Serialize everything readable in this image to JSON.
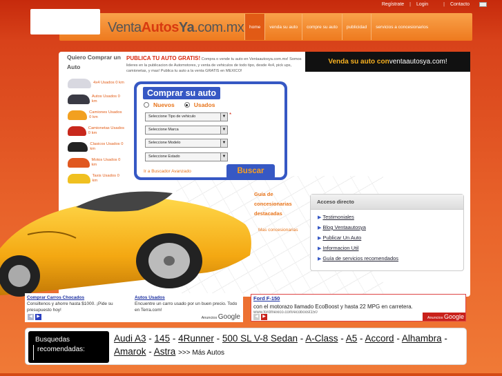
{
  "toplinks": {
    "registrate": "Regístrate",
    "login": "Login",
    "contacto": "Contacto"
  },
  "logo": {
    "part1": "Venta",
    "part2": "Autos",
    "part3": "Ya",
    "part4": ".com.mx"
  },
  "nav": [
    "home",
    "venda su auto",
    "compre su auto",
    "publicidad",
    "servicios a concesionarios"
  ],
  "sidebar": {
    "title": "Quiero Comprar un Auto",
    "items": [
      {
        "label": "4x4 Usados 0 km",
        "color": "#d8d8e0"
      },
      {
        "label": "Autos Usados 0 km",
        "color": "#3a3a44"
      },
      {
        "label": "Camiones Usados 0 km",
        "color": "#f2a020"
      },
      {
        "label": "Camionetas Usados 0 km",
        "color": "#c8281c"
      },
      {
        "label": "Clasicos Usados 0 km",
        "color": "#222"
      },
      {
        "label": "Motos Usados 0 km",
        "color": "#e05820"
      },
      {
        "label": "Taxis Usados 0 km",
        "color": "#f0c020"
      }
    ]
  },
  "publica": {
    "heading": "PUBLICA TU AUTO GRATIS!",
    "text": "Compra o vende tu auto en Ventaautosya.com.mx! Somos lideres en la publicacion de Automotores, y venta de vehiculos de todo tipo, desde 4x4, pick ups, camionetas, y mas! Publica tu auto a la venta GRATIS en MEXICO!"
  },
  "vende": {
    "text": "Venda su auto con ",
    "brand": "ventaautosya.com!"
  },
  "search": {
    "title": "Comprar su auto",
    "nuevos": "Nuevos",
    "usados": "Usados",
    "selects": [
      "Seleccione Tipo de vehiculo",
      "Seleccione Marca",
      "Seleccione Modelo",
      "Seleccione Estado"
    ],
    "asterisk": "*",
    "advanced": "Ir a Buscador Avanzado",
    "button": "Buscar"
  },
  "guia": {
    "title": "Guía de concesionarias destacadas",
    "more": "Mas concesionarias"
  },
  "acceso": {
    "title": "Acceso directo",
    "links": [
      "Testimoniales",
      "Blog Ventaautosya",
      "Publicar Un Auto",
      "Informacion Util",
      "Guía de servicios recomendados"
    ]
  },
  "ads": {
    "ad1": {
      "title": "Comprar Carros Chocados",
      "text": "Consiltenos y ahorre hasta $1000. ¡Pide su presupuesto hoy!"
    },
    "ad2": {
      "title": "Autos Usados",
      "text": "Encuentre un carro usado por un buen precio. Todo en Terra.com!"
    },
    "anuncios": "Anuncios ",
    "google": "Google"
  },
  "ford": {
    "title": "Ford F-150",
    "text": "con el motorazo llamado EcoBoost y hasta 22 MPG en carretera.",
    "url": "www.fordmexico.com/ecoboost150",
    "anuncios": "Anuncios ",
    "google": "Google"
  },
  "busquedas": {
    "title": "Busquedas",
    "subtitle": "recomendadas:",
    "links": [
      "Audi A3",
      "145",
      "4Runner",
      "500 SL V-8 Sedan",
      "A-Class",
      "A5",
      "Accord",
      "Alhambra",
      "Amarok",
      "Astra"
    ],
    "more": ">>> Más Autos"
  },
  "colors": {
    "accent": "#3658c4",
    "orange": "#e8741a",
    "red": "#d83a10",
    "car": "#f4b81a"
  }
}
